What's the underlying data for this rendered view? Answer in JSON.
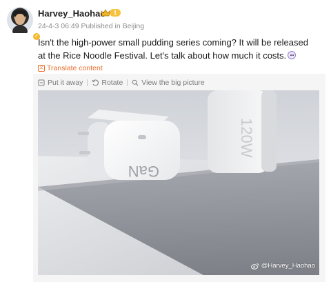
{
  "user": {
    "name": "Harvey_Haohao",
    "vip_level": "1",
    "meta": "24-4-3 06:49 Published in Beijing"
  },
  "post": {
    "text": "Isn't the high-power small pudding series coming? It will be released at the Rice Noodle Festival. Let's talk about how much it costs.",
    "translate_label": "Translate content"
  },
  "toolbar": {
    "put_away": "Put it away",
    "rotate": "Rotate",
    "view_big": "View the big picture"
  },
  "image": {
    "watermark": "@Harvey_Haohao",
    "charger_left_label": "GaN",
    "charger_right_label": "120W"
  },
  "colors": {
    "accent_orange": "#e96d2b",
    "vip_gold": "#f6c23b"
  }
}
